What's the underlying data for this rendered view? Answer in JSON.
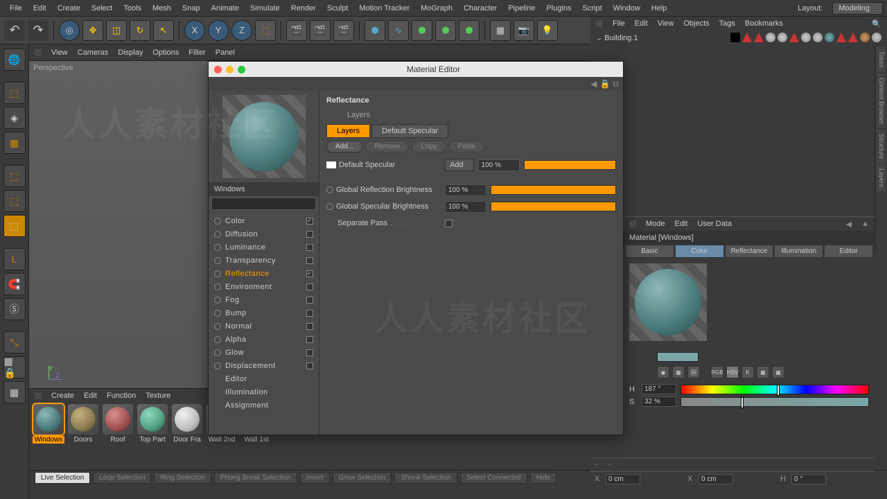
{
  "menubar": [
    "File",
    "Edit",
    "Create",
    "Select",
    "Tools",
    "Mesh",
    "Snap",
    "Animate",
    "Simulate",
    "Render",
    "Sculpt",
    "Motion Tracker",
    "MoGraph",
    "Character",
    "Pipeline",
    "Plugins",
    "Script",
    "Window",
    "Help"
  ],
  "layout": {
    "label": "Layout:",
    "value": "Modeling"
  },
  "toolbar_axis": [
    "X",
    "Y",
    "Z"
  ],
  "obj_menu": [
    "File",
    "Edit",
    "View",
    "Objects",
    "Tags",
    "Bookmarks"
  ],
  "obj_tree_item": "Building.1",
  "right_tabs": [
    "Takes",
    "Content Browser",
    "Structure",
    "Layers"
  ],
  "vp_menu": [
    "View",
    "Cameras",
    "Display",
    "Options",
    "Filter",
    "Panel"
  ],
  "vp_label": "Perspective",
  "matmgr_menu": [
    "Create",
    "Edit",
    "Function",
    "Texture"
  ],
  "materials": [
    {
      "name": "Windows",
      "color": "radial-gradient(circle at 35% 30%,#8fb8b8,#4a7a7a 60%,#2a4a4a)"
    },
    {
      "name": "Doors",
      "color": "radial-gradient(circle at 35% 30%,#c8b080,#8a7a50 60%,#4a3a20)"
    },
    {
      "name": "Roof",
      "color": "radial-gradient(circle at 35% 30%,#d89090,#a05050 60%,#502020)"
    },
    {
      "name": "Top Part",
      "color": "radial-gradient(circle at 35% 30%,#90d8c0,#50a080 60%,#205040)"
    },
    {
      "name": "Door Fra",
      "color": "radial-gradient(circle at 35% 30%,#f0f0f0,#c0c0c0 60%,#808080)"
    },
    {
      "name": "Wall 2nd",
      "color": "radial-gradient(circle at 35% 30%,#ddd,#aaa 60%,#666)"
    },
    {
      "name": "Wall 1st",
      "color": "radial-gradient(circle at 35% 30%,#ddd,#aaa 60%,#666)"
    }
  ],
  "selbar": [
    "Live Selection",
    "Loop Selection",
    "Ring Selection",
    "Phong Break Selection",
    "Invert",
    "Grow Selection",
    "Shrink Selection",
    "Select Connected",
    "Hide"
  ],
  "mateditor": {
    "title": "Material Editor",
    "matname": "Windows",
    "channels": [
      {
        "label": "Color",
        "checked": true,
        "active": false
      },
      {
        "label": "Diffusion",
        "checked": false,
        "active": false
      },
      {
        "label": "Luminance",
        "checked": false,
        "active": false
      },
      {
        "label": "Transparency",
        "checked": false,
        "active": false
      },
      {
        "label": "Reflectance",
        "checked": true,
        "active": true
      },
      {
        "label": "Environment",
        "checked": false,
        "active": false
      },
      {
        "label": "Fog",
        "checked": false,
        "active": false
      },
      {
        "label": "Bump",
        "checked": false,
        "active": false
      },
      {
        "label": "Normal",
        "checked": false,
        "active": false
      },
      {
        "label": "Alpha",
        "checked": false,
        "active": false
      },
      {
        "label": "Glow",
        "checked": false,
        "active": false
      },
      {
        "label": "Displacement",
        "checked": false,
        "active": false
      }
    ],
    "channels_noradio": [
      "Editor",
      "Illumination",
      "Assignment"
    ],
    "heading": "Reflectance",
    "sub": "Layers",
    "tabs": [
      "Layers",
      "Default Specular"
    ],
    "btns": [
      "Add...",
      "Remove",
      "Copy",
      "Paste"
    ],
    "layer_row": {
      "name": "Default Specular",
      "mode": "Add",
      "value": "100 %"
    },
    "global_rows": [
      {
        "label": "Global Reflection Brightness",
        "value": "100 %"
      },
      {
        "label": "Global Specular Brightness",
        "value": "100 %"
      }
    ],
    "sep_label": "Separate Pass"
  },
  "attrib": {
    "menu": [
      "Mode",
      "Edit",
      "User Data"
    ],
    "title": "Material [Windows]",
    "tabs": [
      "Basic",
      "Color",
      "Reflectance",
      "Illumination",
      "Editor"
    ],
    "active_tab": "Color",
    "icon_row": [
      "RGB",
      "HSV",
      "K"
    ],
    "hue": {
      "label": "H",
      "value": "187 °",
      "pos": "51%"
    },
    "sat": {
      "label": "S",
      "value": "32 %",
      "pos": "32%"
    }
  },
  "coords": {
    "x": {
      "label": "X",
      "val": "0 cm"
    },
    "x2": {
      "label": "X",
      "val": "0 cm"
    },
    "h": {
      "label": "H",
      "val": "0 °"
    }
  },
  "watermark": "人人素材社区"
}
